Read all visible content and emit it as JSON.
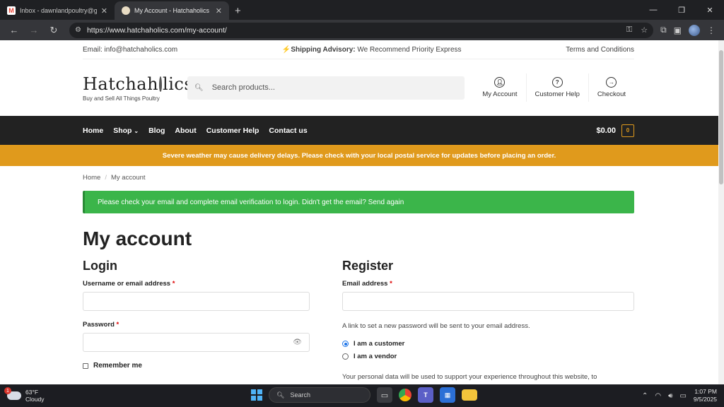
{
  "browser": {
    "tabs": [
      {
        "title": "Inbox - dawnlandpoultry@gma",
        "favicon": "gmail-icon",
        "active": false
      },
      {
        "title": "My Account - Hatchaholics",
        "favicon": "hatchaholics-favicon",
        "active": true
      }
    ],
    "url": "https://www.hatchaholics.com/my-account/"
  },
  "topbar": {
    "email": "Email: info@hatchaholics.com",
    "advisory_label": "Shipping Advisory:",
    "advisory_text": " We Recommend Priority Express",
    "terms": "Terms and Conditions"
  },
  "header": {
    "logo_left": "Hatchah",
    "logo_right": "lics",
    "tagline": "Buy and Sell All Things Poultry",
    "search_placeholder": "Search products...",
    "links": [
      {
        "label": "My Account",
        "icon": "user-icon"
      },
      {
        "label": "Customer Help",
        "icon": "help-icon"
      },
      {
        "label": "Checkout",
        "icon": "arrow-right-circle-icon"
      }
    ]
  },
  "nav": {
    "items": [
      "Home",
      "Shop",
      "Blog",
      "About",
      "Customer Help",
      "Contact us"
    ],
    "cart_total": "$0.00",
    "cart_count": "0"
  },
  "alert_banner": "Severe weather may cause delivery delays. Please check with your local postal service for updates before placing an order.",
  "breadcrumb": {
    "home": "Home",
    "current": "My account"
  },
  "notice": "Please check your email and complete email verification to login. Didn't get the email? Send again",
  "page_title": "My account",
  "login": {
    "heading": "Login",
    "username_label": "Username or email address",
    "password_label": "Password",
    "required_mark": "*",
    "remember": "Remember me"
  },
  "register": {
    "heading": "Register",
    "email_label": "Email address",
    "required_mark": "*",
    "hint": "A link to set a new password will be sent to your email address.",
    "role_customer": "I am a customer",
    "role_vendor": "I am a vendor",
    "role_selected": "customer",
    "privacy_partial": "Your personal data will be used to support your experience throughout this website, to"
  },
  "taskbar": {
    "temp": "63°F",
    "condition": "Cloudy",
    "weather_badge": "1",
    "search": "Search",
    "time": "1:07 PM",
    "date": "9/5/2025"
  },
  "colors": {
    "accent_orange": "#e09a1c",
    "notice_green": "#3bb54a",
    "nav_dark": "#222222"
  }
}
